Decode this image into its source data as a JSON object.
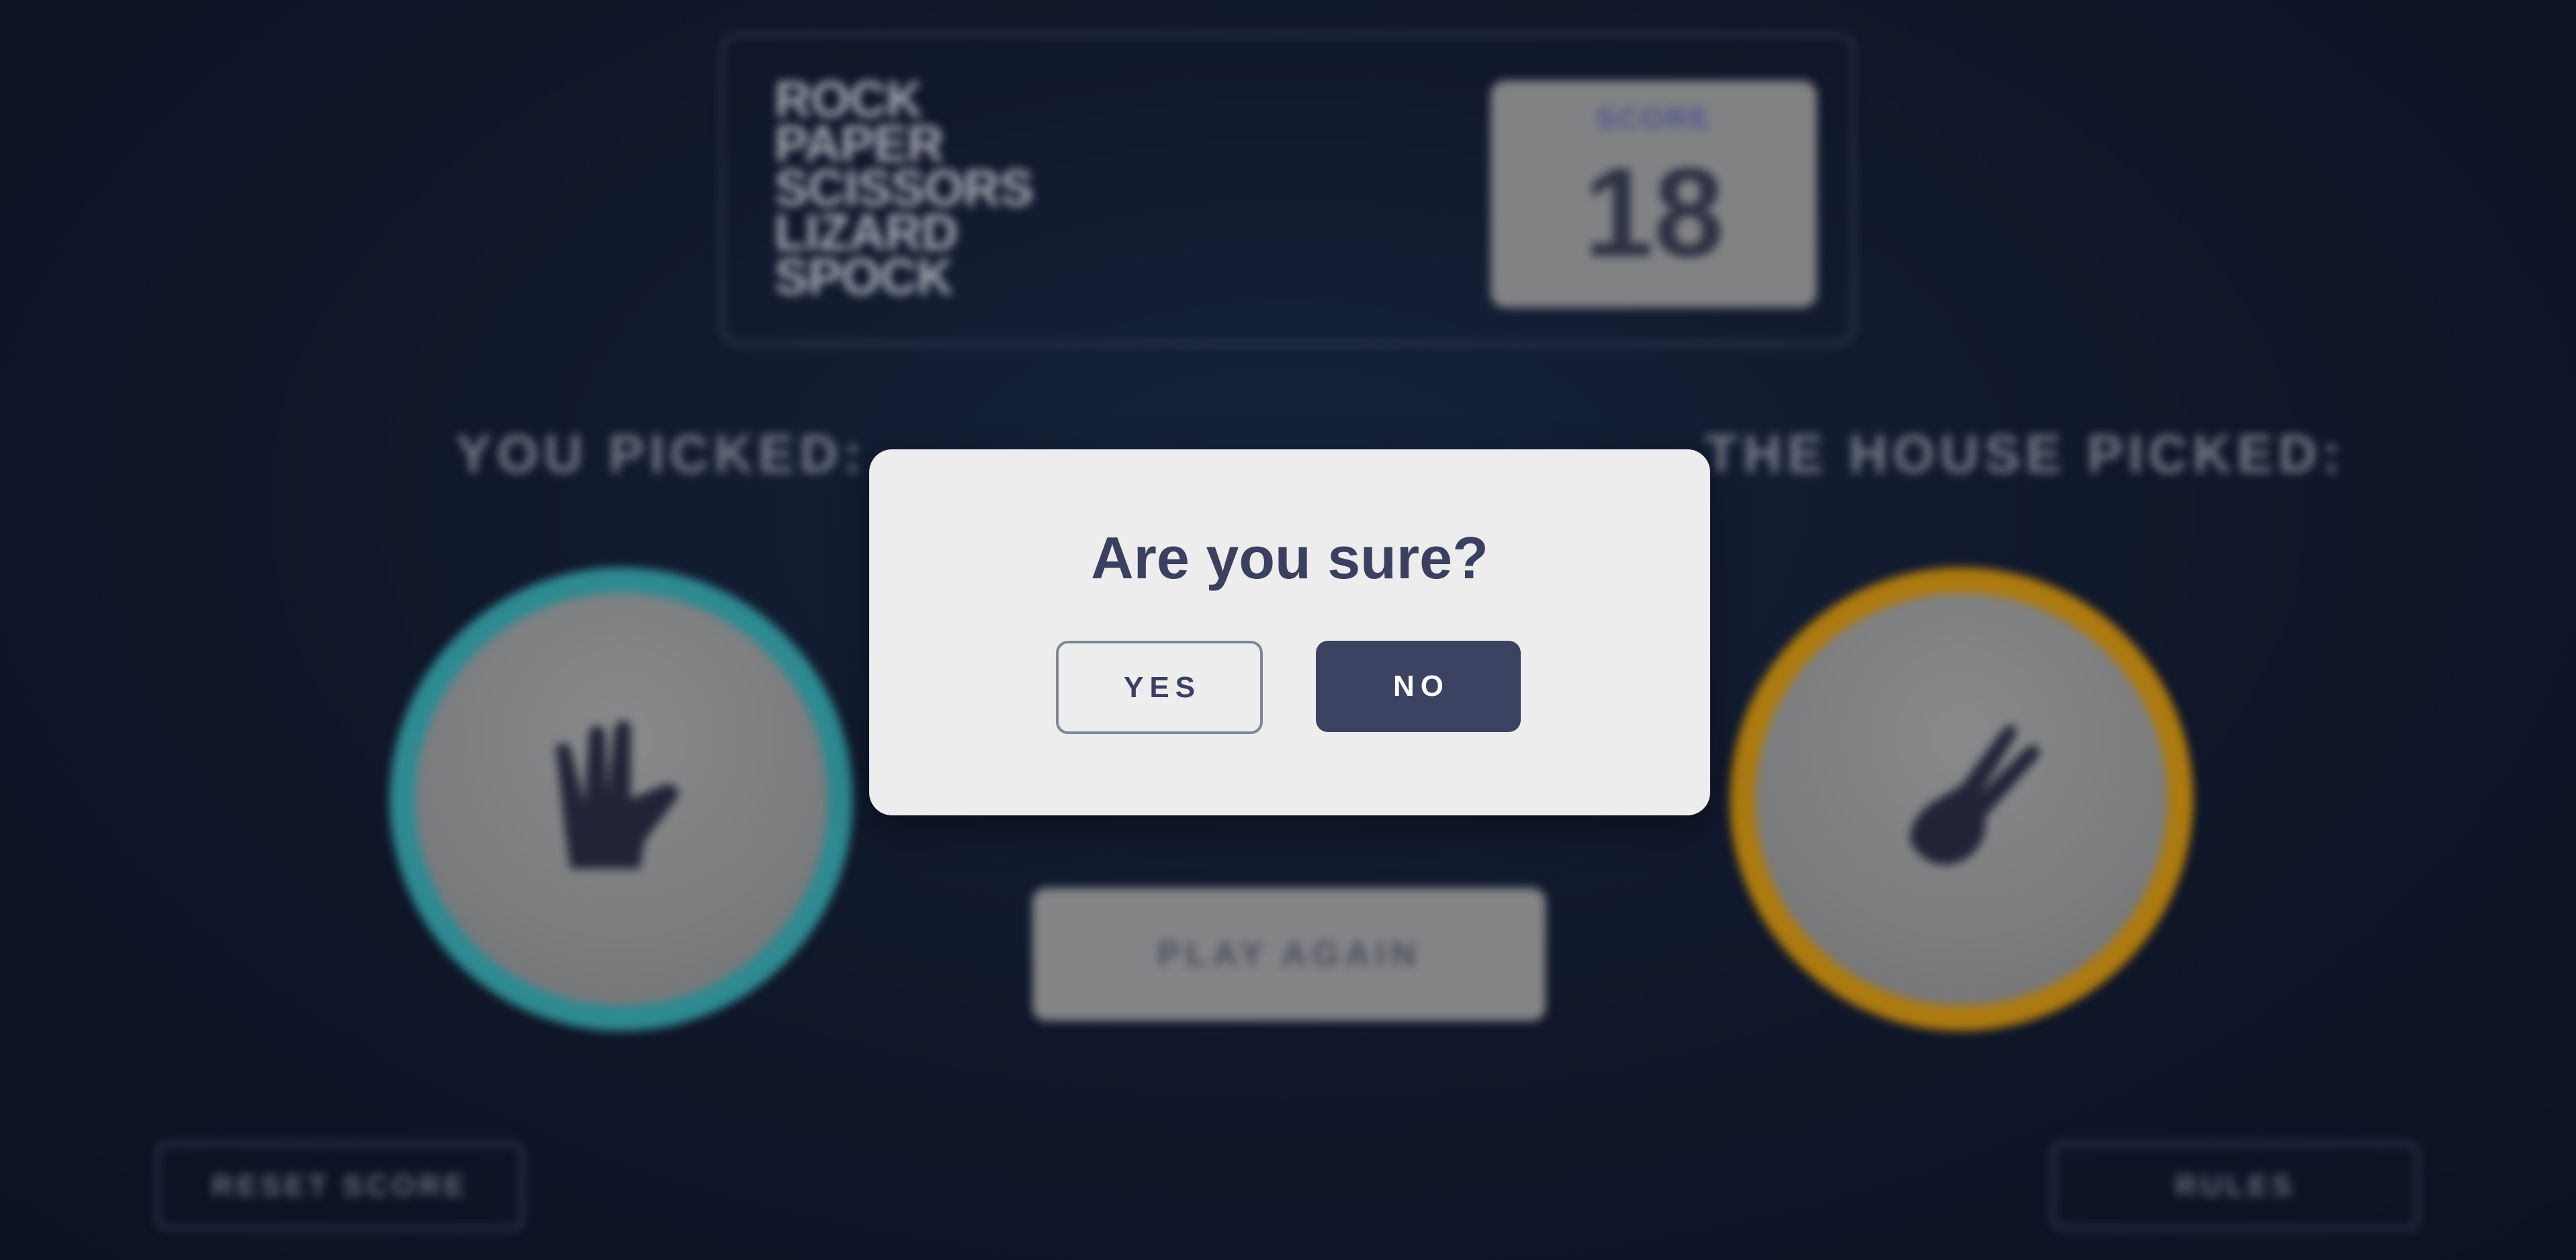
{
  "header": {
    "game_title_lines": [
      "ROCK",
      "PAPER",
      "SCISSORS",
      "LIZARD",
      "SPOCK"
    ],
    "score_label": "SCORE",
    "score_value": "18"
  },
  "result": {
    "user_label": "YOU PICKED:",
    "house_label": "THE HOUSE PICKED:",
    "user_pick_icon": "spock-hand-icon",
    "house_pick_icon": "scissors-hand-icon",
    "user_ring_color": "#38a6ad",
    "house_ring_color": "#d2930f",
    "play_again_label": "PLAY AGAIN"
  },
  "footer": {
    "reset_label": "RESET SCORE",
    "rules_label": "RULES"
  },
  "modal": {
    "title": "Are you sure?",
    "yes_label": "YES",
    "no_label": "NO",
    "no_color": "#3c4262"
  }
}
